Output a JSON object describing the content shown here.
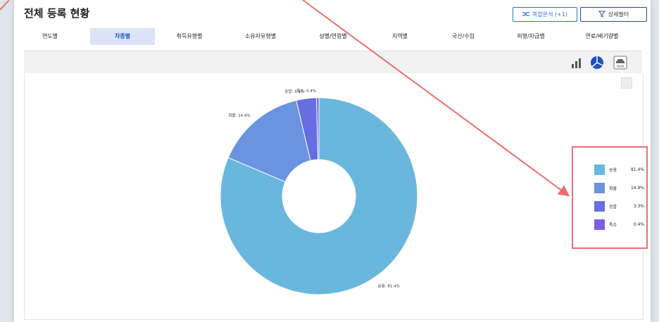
{
  "header": {
    "title": "전체 등록 현황",
    "combine_label": "복합분석 (+1)",
    "filter_label": "상세필터"
  },
  "tabs": [
    {
      "label": "연도별",
      "active": false
    },
    {
      "label": "차종별",
      "active": true
    },
    {
      "label": "취득유형별",
      "active": false
    },
    {
      "label": "소유자유형별",
      "active": false
    },
    {
      "label": "성별/연령별",
      "active": false
    },
    {
      "label": "지역별",
      "active": false
    },
    {
      "label": "국산/수입",
      "active": false
    },
    {
      "label": "외형/차급별",
      "active": false
    },
    {
      "label": "연료/배기량별",
      "active": false
    }
  ],
  "toolbar": {
    "bar_icon": "bar-chart-icon",
    "pie_icon": "pie-chart-icon",
    "year_icon": "year-car-icon",
    "year_label": "YEAR"
  },
  "chart_data": {
    "type": "pie",
    "donut": true,
    "title": "",
    "slices": [
      {
        "label": "승용",
        "value": 81.4,
        "color": "#69b7dd"
      },
      {
        "label": "화물",
        "value": 14.9,
        "color": "#6a94e0"
      },
      {
        "label": "승합",
        "value": 3.3,
        "color": "#676ee2"
      },
      {
        "label": "특수",
        "value": 0.4,
        "color": "#7d5ee3"
      }
    ],
    "data_labels": [
      {
        "text": "승용: 81.4%"
      },
      {
        "text": "화물: 14.9%"
      },
      {
        "text": "승합: 3.3%"
      },
      {
        "text": "특수: 0.4%"
      }
    ],
    "legend": {
      "position": "right",
      "items": [
        {
          "name": "승용",
          "value": "81.4%"
        },
        {
          "name": "화물",
          "value": "14.9%"
        },
        {
          "name": "승합",
          "value": "3.3%"
        },
        {
          "name": "특수",
          "value": "0.4%"
        }
      ]
    }
  },
  "annotation": {
    "color": "#ea6f6f"
  }
}
